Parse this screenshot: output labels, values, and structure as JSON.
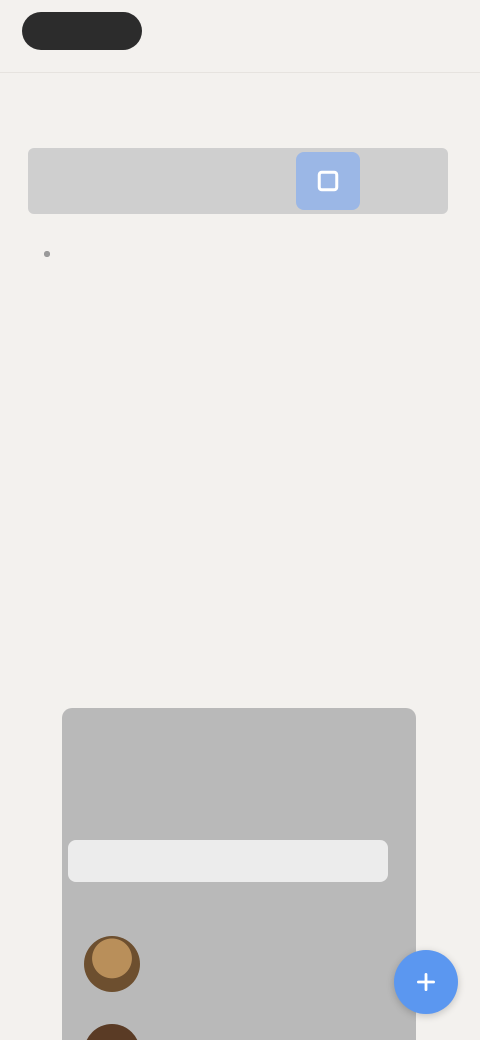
{
  "topbar": {
    "back_label": "",
    "right_label": ""
  },
  "article": {
    "title": "",
    "intro": "",
    "after_banner": "",
    "features": [
      {
        "title": "",
        "text": ""
      },
      {
        "title": "",
        "text": ""
      },
      {
        "title": "",
        "text": ""
      },
      {
        "title": "",
        "text": ""
      }
    ]
  },
  "banner": {
    "highlight_icon": "square-icon"
  },
  "screenshot": {
    "top_left": "",
    "top_right": "",
    "heading": "",
    "search_placeholder": "",
    "subheading": "",
    "row1": "",
    "row2": ""
  },
  "fab": {
    "icon": "plus-icon",
    "color": "#5b97f0"
  },
  "colors": {
    "background": "#f3f1ee",
    "accent": "#5b97f0",
    "banner": "#cfcfcf",
    "highlight": "#9bb7e6"
  }
}
